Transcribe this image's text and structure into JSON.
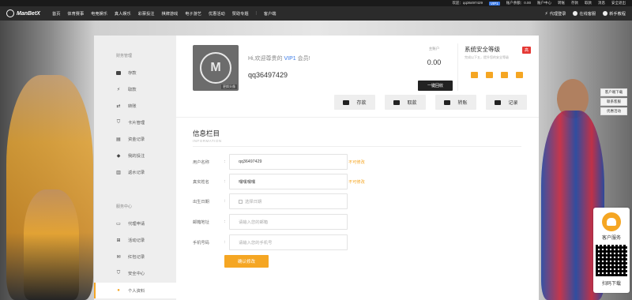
{
  "topbar": {
    "welcome": "欢迎：qq36497429",
    "vip": "VIP1",
    "balance": "账户余额：0.00",
    "links": [
      "账户中心",
      "转账",
      "存款",
      "取款",
      "消息",
      "安全退出"
    ]
  },
  "nav": {
    "logo": "ManBetX",
    "items": [
      "首页",
      "体育赛事",
      "电竞娱乐",
      "真人娱乐",
      "彩票投注",
      "棋牌游戏",
      "电子游艺",
      "优惠活动",
      "赞助专题",
      "|",
      "客户端"
    ],
    "right": [
      "代理登录",
      "在线客服",
      "新手教程"
    ]
  },
  "sidebar": {
    "section1": "财务管理",
    "items1": [
      {
        "label": "存款",
        "icon": "wallet-icon"
      },
      {
        "label": "取款",
        "icon": "bolt-icon"
      },
      {
        "label": "转账",
        "icon": "transfer-icon"
      },
      {
        "label": "卡片管理",
        "icon": "shield-icon"
      },
      {
        "label": "资金记录",
        "icon": "document-icon"
      },
      {
        "label": "我的投注",
        "icon": "diamond-icon"
      },
      {
        "label": "返水记录",
        "icon": "receipt-icon"
      }
    ],
    "section2": "服务中心",
    "items2": [
      {
        "label": "代理申请",
        "icon": "monitor-icon"
      },
      {
        "label": "活动记录",
        "icon": "gift-icon"
      },
      {
        "label": "红包记录",
        "icon": "envelope-icon"
      },
      {
        "label": "安全中心",
        "icon": "shield-check-icon"
      },
      {
        "label": "个人资料",
        "icon": "user-icon"
      }
    ]
  },
  "profile": {
    "avatar_caption": "更换头像",
    "welcome_prefix": "Hi,欢迎尊贵的",
    "vip": "VIP1",
    "welcome_suffix": "会员!",
    "username": "qq36497429",
    "wallet_label": "主账户",
    "wallet_amount": "0.00",
    "recycle_button": "一键回收",
    "security_title": "系统安全等级",
    "security_sub": "完成以下五，提升您的安全等级",
    "security_level": "高"
  },
  "actions": [
    {
      "label": "存款"
    },
    {
      "label": "取款"
    },
    {
      "label": "转账"
    },
    {
      "label": "记录"
    }
  ],
  "info": {
    "title": "信息栏目",
    "subtitle": "INFORMATION",
    "fields": [
      {
        "label": "用户名称",
        "value": "qq36497429",
        "note": "不可修改"
      },
      {
        "label": "真实姓名",
        "value": "嘿嘿嘿嘿",
        "note": "不可修改"
      },
      {
        "label": "出生日期",
        "value": "选择日期",
        "note": ""
      },
      {
        "label": "邮箱地址",
        "value": "请输入您的邮箱",
        "note": ""
      },
      {
        "label": "手机号码",
        "value": "请输入您的手机号",
        "note": ""
      }
    ],
    "submit": "确认修改"
  },
  "right_float": {
    "links": [
      "客户端下载",
      "联系客服",
      "优惠活动"
    ],
    "service": "客户服务",
    "download": "扫码下载"
  },
  "colors": {
    "accent": "#f5a623",
    "vip": "#3b7be8",
    "nav": "#2b2b2b"
  }
}
